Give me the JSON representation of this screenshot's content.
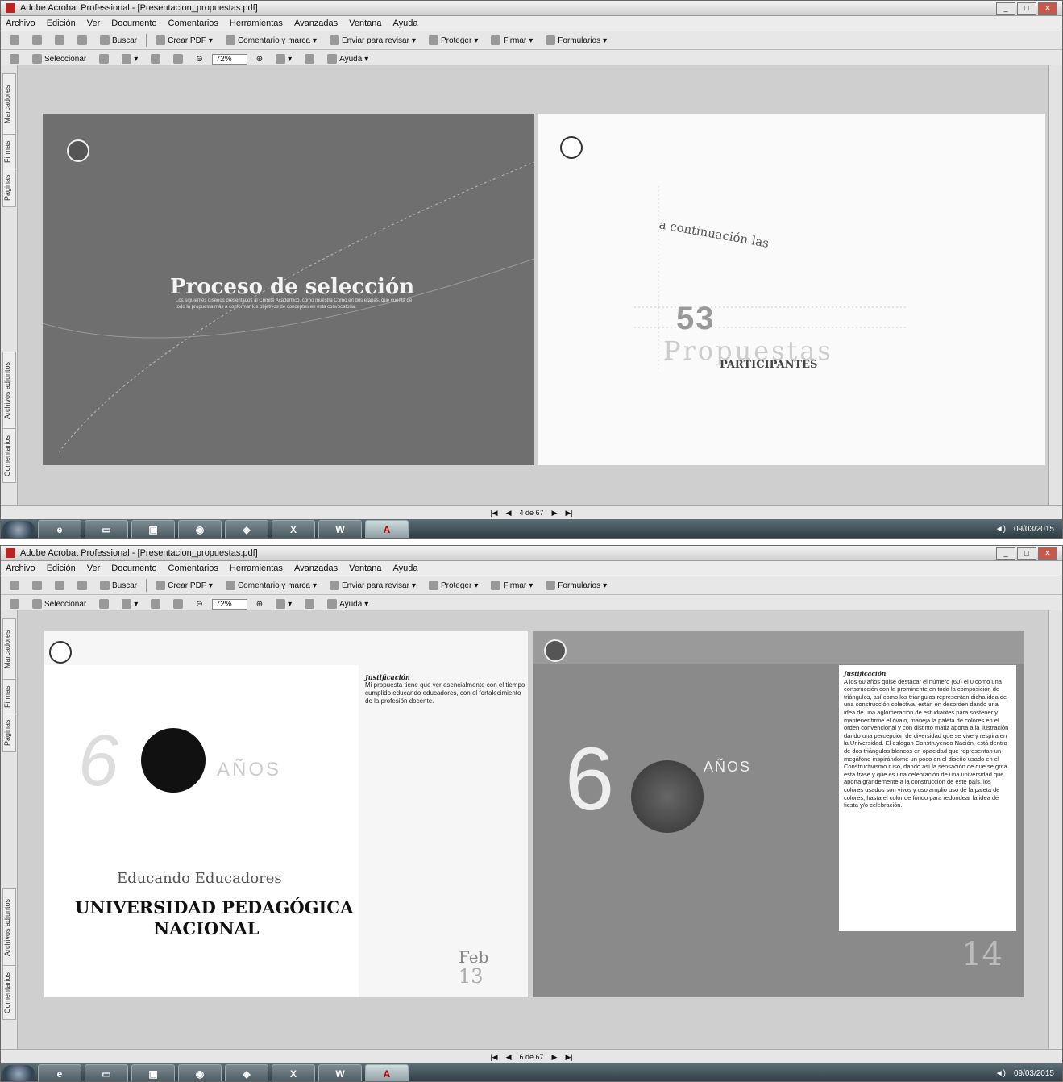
{
  "window1": {
    "title": "Adobe Acrobat Professional - [Presentacion_propuestas.pdf]",
    "menu": [
      "Archivo",
      "Edición",
      "Ver",
      "Documento",
      "Comentarios",
      "Herramientas",
      "Avanzadas",
      "Ventana",
      "Ayuda"
    ],
    "toolbar1": [
      "Buscar",
      "Crear PDF",
      "Comentario y marca",
      "Enviar para revisar",
      "Proteger",
      "Firmar",
      "Formularios"
    ],
    "toolbar2": {
      "select": "Seleccionar",
      "zoom": "72%",
      "help": "Ayuda"
    },
    "sidetabs": [
      "Marcadores",
      "Firmas",
      "Páginas",
      "Archivos adjuntos",
      "Comentarios"
    ],
    "page_indicator": "4 de 67",
    "clock": "09/03/2015",
    "slide_left": {
      "title": "Proceso de selección",
      "body": "Los siguientes diseños presentados al Comité Académico, como muestra Cómo en dos etapas, que cuenta de todo la propuesta más a conformar los objetivos de conceptos en esta convocatoria."
    },
    "slide_right": {
      "arc": "a continuación las",
      "number": "53",
      "word": "Propuestas",
      "sub": "PARTICIPANTES"
    }
  },
  "window2": {
    "title": "Adobe Acrobat Professional - [Presentacion_propuestas.pdf]",
    "menu": [
      "Archivo",
      "Edición",
      "Ver",
      "Documento",
      "Comentarios",
      "Herramientas",
      "Avanzadas",
      "Ventana",
      "Ayuda"
    ],
    "toolbar1": [
      "Buscar",
      "Crear PDF",
      "Comentario y marca",
      "Enviar para revisar",
      "Proteger",
      "Firmar",
      "Formularios"
    ],
    "toolbar2": {
      "select": "Seleccionar",
      "zoom": "72%",
      "help": "Ayuda"
    },
    "sidetabs": [
      "Marcadores",
      "Firmas",
      "Páginas",
      "Archivos adjuntos",
      "Comentarios"
    ],
    "page_indicator": "6 de 67",
    "clock": "09/03/2015",
    "card_left": {
      "six": "6",
      "anos": "AÑOS",
      "slogan": "Educando Educadores",
      "uni1": "UNIVERSIDAD PEDAGÓGICA",
      "uni2": "NACIONAL",
      "just_title": "Justificación",
      "just_body": "Mi propuesta tiene que ver esencialmente con el tiempo cumplido educando educadores, con el fortalecimiento de la profesión docente.",
      "date_month": "Feb",
      "date_day": "13"
    },
    "card_right": {
      "six": "6",
      "anos": "AÑOS",
      "just_title": "Justificación",
      "just_body": "A los 60 años quise destacar el número (60) el 0 como una construcción con la prominente en toda la composición de triángulos, así como los triángulos representan dicha idea de una construcción colectiva, están en desorden dando una idea de una aglomeración de estudiantes para sostener y mantener firme el óvalo, maneja la paleta de colores en el orden convencional y con distinto matiz aporta a la ilustración dando una percepción de diversidad que se vive y respira en la Universidad. El eslogan Construyendo Nación, está dentro de dos triángulos blancos en opacidad que representan un megáfono inspirándome un poco en el diseño usado en el Constructivismo ruso, dando así la sensación de que se grita esta frase y que es una celebración de una universidad que aporta grandemente a la construcción de este país, los colores usados son vivos y uso amplio uso de la paleta de colores, hasta el color de fondo para redondear la idea de fiesta y/o celebración.",
      "date": "14"
    }
  }
}
